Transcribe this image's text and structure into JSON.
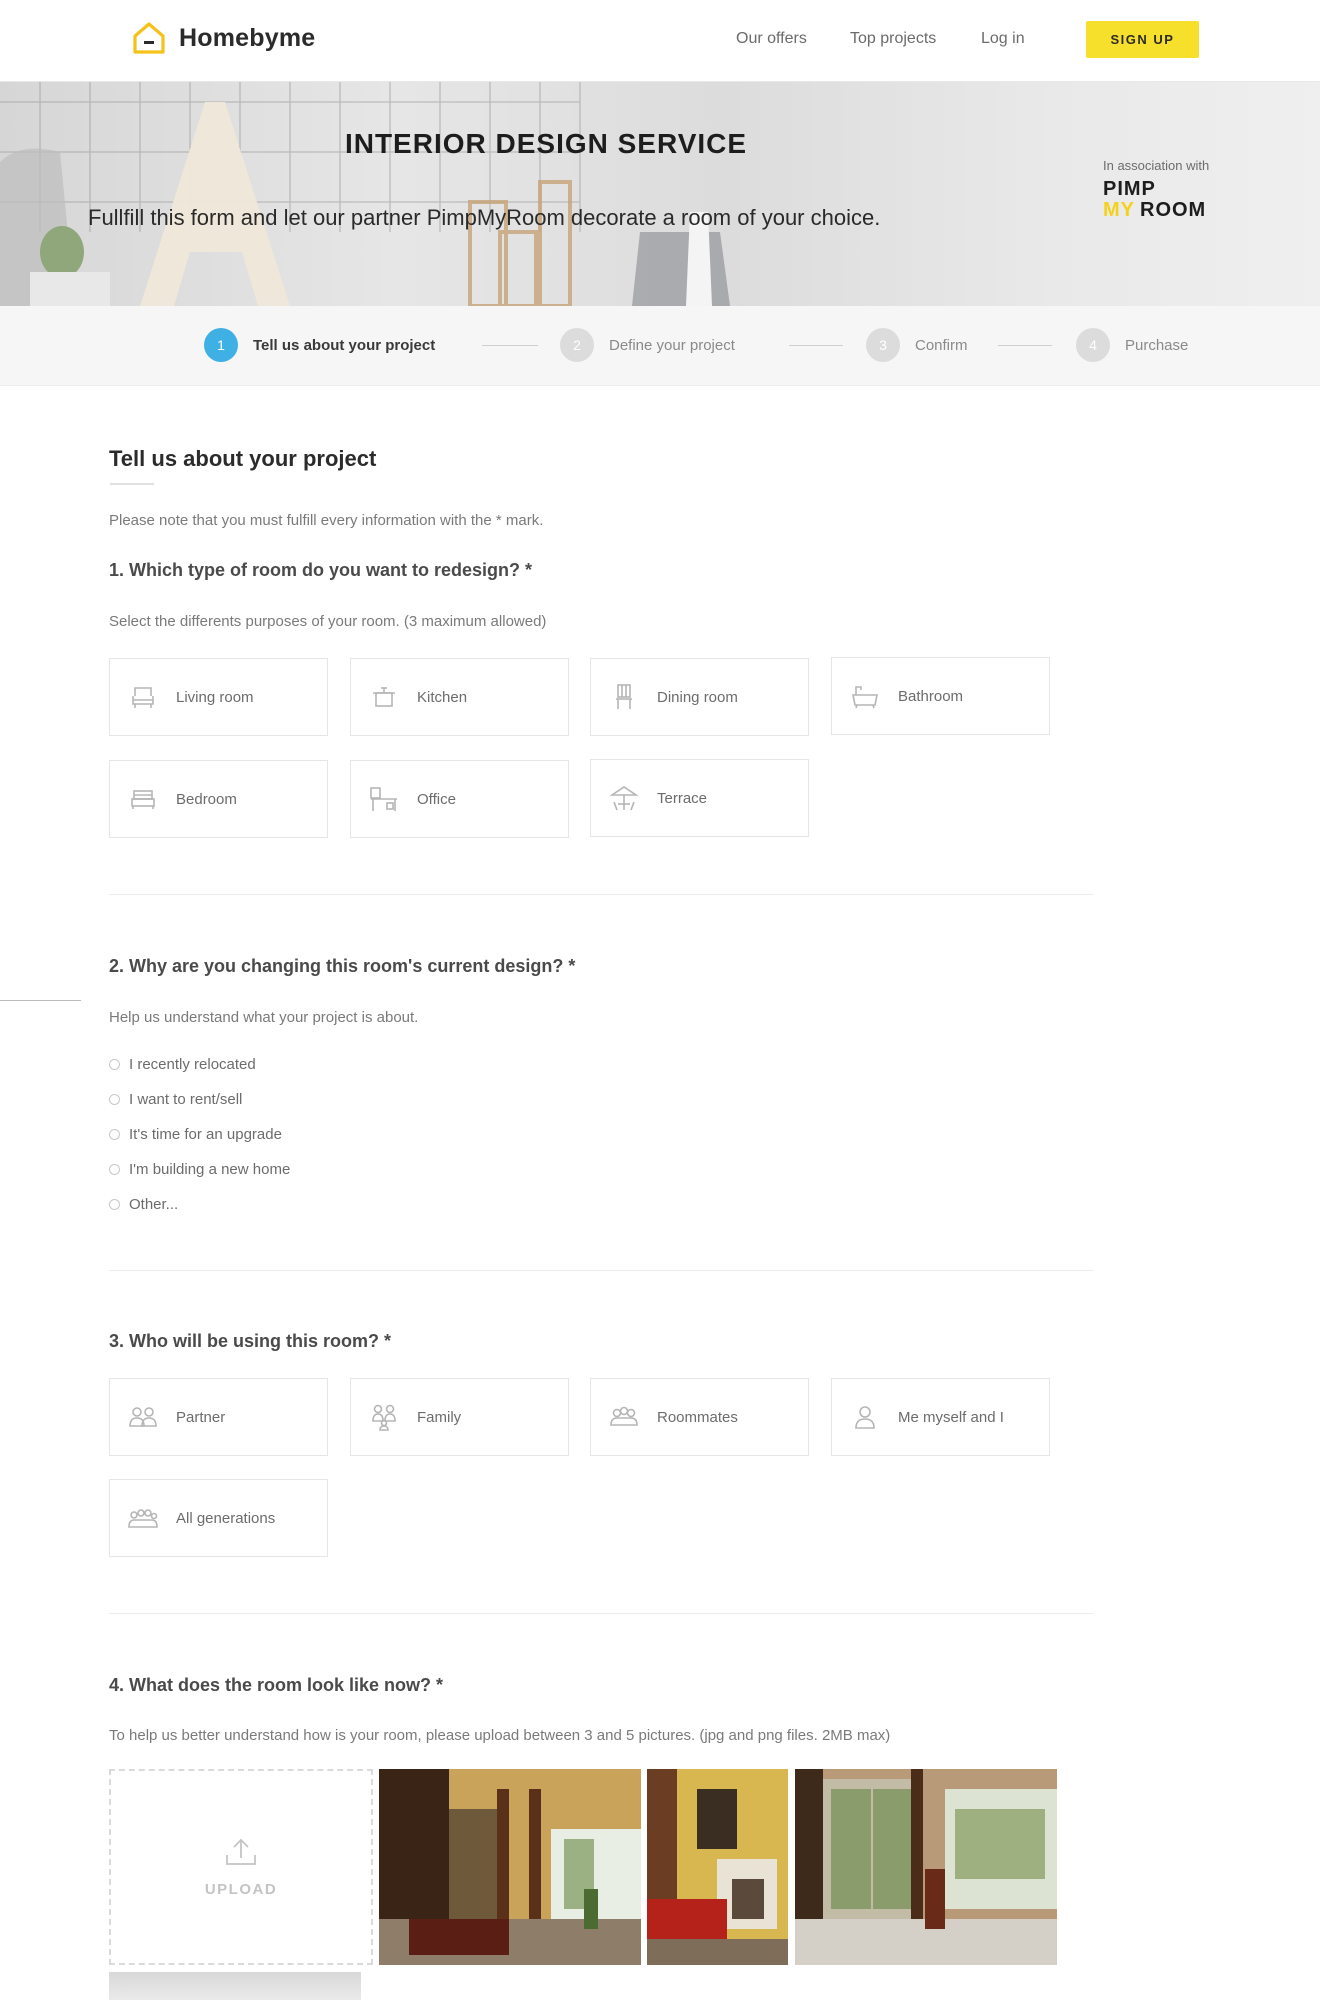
{
  "header": {
    "brand": "Homebyme",
    "nav": {
      "offers": "Our offers",
      "top_projects": "Top projects",
      "login": "Log in"
    },
    "signup_label": "SIGN UP",
    "colors": {
      "accent_yellow": "#f7e02b"
    }
  },
  "hero": {
    "title": "INTERIOR DESIGN SERVICE",
    "subtitle": "Fullfill this form and let our partner PimpMyRoom decorate a room of your choice.",
    "association": "In association with",
    "partner_logo_line1": "PIMP",
    "partner_logo_my": "MY",
    "partner_logo_room": "ROOM"
  },
  "stepper": {
    "active_color": "#3fb0e3",
    "steps": [
      {
        "num": "1",
        "label": "Tell us about your project"
      },
      {
        "num": "2",
        "label": "Define your project"
      },
      {
        "num": "3",
        "label": "Confirm"
      },
      {
        "num": "4",
        "label": "Purchase"
      }
    ]
  },
  "form": {
    "title": "Tell us about your project",
    "note": "Please note that you must fulfill every information with the * mark.",
    "q1": {
      "question": "1. Which type of room do you want to redesign? *",
      "help": "Select the differents purposes of your room. (3 maximum allowed)",
      "options": [
        {
          "label": "Living room",
          "icon": "sofa-icon"
        },
        {
          "label": "Kitchen",
          "icon": "pot-icon"
        },
        {
          "label": "Dining room",
          "icon": "chair-icon"
        },
        {
          "label": "Bathroom",
          "icon": "bathtub-icon"
        },
        {
          "label": "Bedroom",
          "icon": "bed-icon"
        },
        {
          "label": "Office",
          "icon": "desk-icon"
        },
        {
          "label": "Terrace",
          "icon": "parasol-icon"
        }
      ]
    },
    "q2": {
      "question": "2. Why are you changing this room's current design? *",
      "help": "Help us understand what your project is about.",
      "options": [
        "I recently relocated",
        "I want to rent/sell",
        "It's time for an upgrade",
        "I'm building a new home",
        "Other..."
      ]
    },
    "q3": {
      "question": "3. Who will be using this room? *",
      "options": [
        {
          "label": "Partner",
          "icon": "two-people-icon"
        },
        {
          "label": "Family",
          "icon": "family-icon"
        },
        {
          "label": "Roommates",
          "icon": "group-icon"
        },
        {
          "label": "Me myself and I",
          "icon": "person-icon"
        },
        {
          "label": "All generations",
          "icon": "generations-icon"
        }
      ]
    },
    "q4": {
      "question": "4. What does the room look like now? *",
      "help": "To help us better understand how is your room, please upload between 3 and 5 pictures. (jpg and png files. 2MB max)",
      "upload_label": "UPLOAD"
    }
  }
}
